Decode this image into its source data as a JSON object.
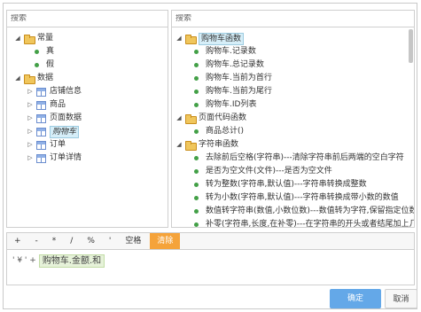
{
  "left_panel": {
    "search_placeholder": "搜索",
    "tree": [
      {
        "label": "常量",
        "expanded": true,
        "children": [
          {
            "label": "真"
          },
          {
            "label": "假"
          }
        ]
      },
      {
        "label": "数据",
        "expanded": true,
        "children": [
          {
            "label": "店铺信息"
          },
          {
            "label": "商品"
          },
          {
            "label": "页面数据"
          },
          {
            "label": "购物车",
            "selected": true
          },
          {
            "label": "订单"
          },
          {
            "label": "订单详情"
          }
        ]
      }
    ]
  },
  "right_panel": {
    "search_placeholder": "搜索",
    "groups": [
      {
        "label": "购物车函数",
        "highlighted": true,
        "items": [
          "购物车.记录数",
          "购物车.总记录数",
          "购物车.当前为首行",
          "购物车.当前为尾行",
          "购物车.ID列表"
        ]
      },
      {
        "label": "页面代码函数",
        "items": [
          "商品总计()"
        ]
      },
      {
        "label": "字符串函数",
        "items": [
          "去除前后空格(字符串)---清除字符串前后两端的空白字符",
          "是否为空文件(文件)---是否为空文件",
          "转为整数(字符串,默认值)---字符串转换成整数",
          "转为小数(字符串,默认值)---字符串转换成带小数的数值",
          "数值转字符串(数值,小数位数)---数值转为字符,保留指定位数小数",
          "补零(字符串,长度,在补零)---在字符串的开头或者结尾加上几个零,让字"
        ]
      }
    ]
  },
  "operators": [
    "+",
    "-",
    "*",
    "/",
    "%",
    "'",
    "空格",
    "清除"
  ],
  "expression": {
    "prefix": "' ¥ ' +",
    "token": "购物车.金额.和"
  },
  "buttons": {
    "ok": "确定",
    "cancel": "取消"
  },
  "colors": {
    "clear_button": "#f5a33a",
    "ok_button": "#64a8e8",
    "dot": "#43a047",
    "chip": "#e6f2d9"
  }
}
